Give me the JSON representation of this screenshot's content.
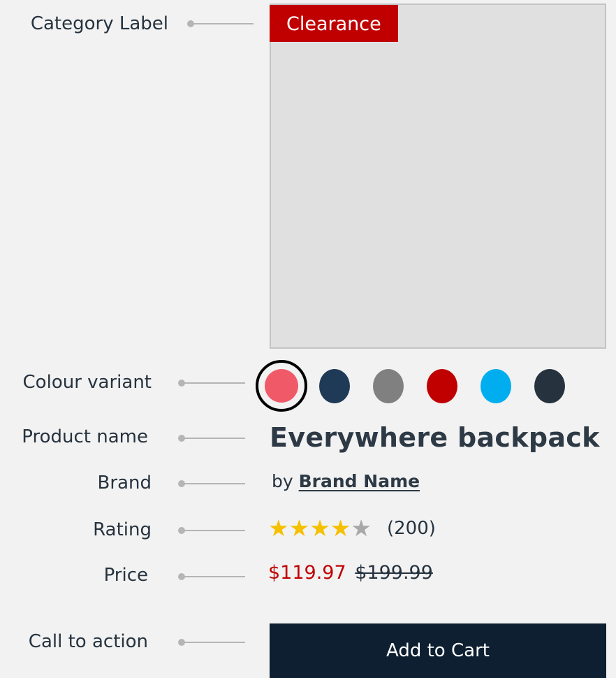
{
  "annotations": {
    "category_label": "Category Label",
    "colour_variant": "Colour variant",
    "product_name": "Product name",
    "brand": "Brand",
    "rating": "Rating",
    "price": "Price",
    "call_to_action": "Call to action"
  },
  "product": {
    "category_badge": "Clearance",
    "name": "Everywhere backpack",
    "brand_prefix": "by",
    "brand_name": "Brand Name",
    "rating_value": 4,
    "rating_max": 5,
    "review_count": "(200)",
    "sale_price": "$119.97",
    "original_price": "$199.99",
    "cta_label": "Add to Cart"
  },
  "swatches": [
    {
      "color": "#f05a68",
      "selected": true
    },
    {
      "color": "#1f3a56",
      "selected": false
    },
    {
      "color": "#808080",
      "selected": false
    },
    {
      "color": "#c00000",
      "selected": false
    },
    {
      "color": "#00aeef",
      "selected": false
    },
    {
      "color": "#26333f",
      "selected": false
    }
  ],
  "icons": {
    "star_filled": "star-filled-icon",
    "star_empty": "star-empty-icon"
  },
  "colors": {
    "badge_bg": "#c00000",
    "sale_price": "#c00000",
    "star_filled": "#f5c000",
    "star_empty": "#a8a8a8",
    "cta_bg": "#0d1f30",
    "connector": "#b5b5b5",
    "image_placeholder": "#e0e0e0"
  }
}
